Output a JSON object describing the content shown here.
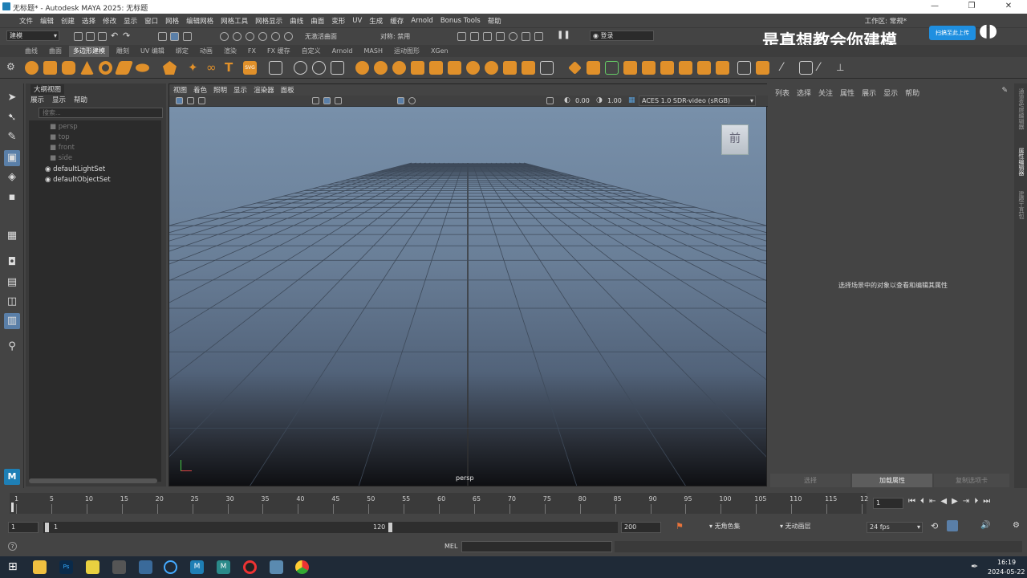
{
  "window": {
    "title": "无标题* - Autodesk MAYA 2025: 无标题",
    "controls": [
      "—",
      "❐",
      "✕"
    ]
  },
  "menus": [
    "文件",
    "编辑",
    "创建",
    "选择",
    "修改",
    "显示",
    "窗口",
    "网格",
    "编辑网格",
    "网格工具",
    "网格显示",
    "曲线",
    "曲面",
    "变形",
    "UV",
    "生成",
    "缓存",
    "Arnold",
    "Bonus Tools",
    "帮助"
  ],
  "workspace_label": "工作区: 常规*",
  "status_line": {
    "mode": "建模",
    "live_surface": "无激活曲面",
    "symmetry": "对称: 禁用",
    "login": "登录"
  },
  "shelf_tabs": [
    "曲线",
    "曲面",
    "多边形建模",
    "雕刻",
    "UV 编辑",
    "绑定",
    "动画",
    "渲染",
    "FX",
    "FX 缓存",
    "自定义",
    "Arnold",
    "MASH",
    "运动图形",
    "XGen"
  ],
  "active_shelf_tab": "多边形建模",
  "outliner": {
    "title": "大纲视图",
    "menu": [
      "展示",
      "显示",
      "帮助"
    ],
    "search_placeholder": "搜索...",
    "items": [
      "persp",
      "top",
      "front",
      "side",
      "defaultLightSet",
      "defaultObjectSet"
    ]
  },
  "viewport": {
    "menu": [
      "视图",
      "着色",
      "照明",
      "显示",
      "渲染器",
      "面板"
    ],
    "exposure": "0.00",
    "gamma": "1.00",
    "color_space": "ACES 1.0 SDR-video (sRGB)",
    "camera_label": "persp",
    "viewcube_label": "前"
  },
  "attribute_editor": {
    "menu": [
      "列表",
      "选择",
      "关注",
      "属性",
      "展示",
      "显示",
      "帮助"
    ],
    "placeholder": "选择场景中的对象以查看和编辑其属性",
    "buttons": [
      "选择",
      "加载属性",
      "复制选项卡"
    ]
  },
  "side_tabs": [
    "通道盒/层编辑器",
    "属性编辑器",
    "建模工具包"
  ],
  "timeline": {
    "ticks": [
      "1",
      "5",
      "10",
      "15",
      "20",
      "25",
      "30",
      "35",
      "40",
      "45",
      "50",
      "55",
      "60",
      "65",
      "70",
      "75",
      "80",
      "85",
      "90",
      "95",
      "100",
      "105",
      "110",
      "115",
      "12"
    ],
    "current_frame": "1"
  },
  "range": {
    "start": "1",
    "inner_start": "1",
    "inner_end": "120",
    "end": "200",
    "character_set": "无角色集",
    "anim_layer": "无动画层",
    "fps": "24 fps"
  },
  "command_line": {
    "language": "MEL"
  },
  "taskbar": {
    "time": "16:19",
    "date": "2024-05-22"
  },
  "watermark": "是真想教会你建模",
  "bili_badge": "扫搞至此上传"
}
